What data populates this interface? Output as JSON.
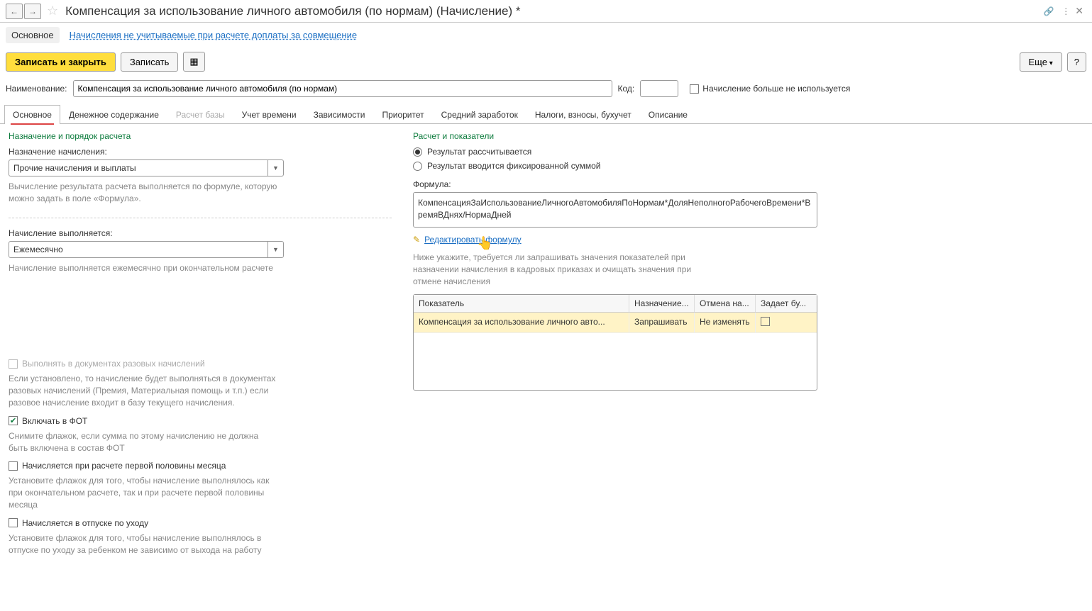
{
  "title": "Компенсация за использование личного автомобиля (по нормам) (Начисление) *",
  "subnav": {
    "main": "Основное",
    "link": "Начисления не учитываемые при расчете доплаты за совмещение"
  },
  "toolbar": {
    "save_close": "Записать и закрыть",
    "save": "Записать",
    "more": "Еще",
    "help": "?"
  },
  "fields": {
    "name_label": "Наименование:",
    "name_value": "Компенсация за использование личного автомобиля (по нормам)",
    "code_label": "Код:",
    "code_value": "",
    "not_used_label": "Начисление больше не используется"
  },
  "tabs": [
    "Основное",
    "Денежное содержание",
    "Расчет базы",
    "Учет времени",
    "Зависимости",
    "Приоритет",
    "Средний заработок",
    "Налоги, взносы, бухучет",
    "Описание"
  ],
  "left": {
    "section": "Назначение и порядок расчета",
    "nazn_label": "Назначение начисления:",
    "nazn_value": "Прочие начисления и выплаты",
    "nazn_hint": "Вычисление результата расчета выполняется по формуле, которую можно задать в поле «Формула».",
    "vyp_label": "Начисление выполняется:",
    "vyp_value": "Ежемесячно",
    "vyp_hint": "Начисление выполняется ежемесячно при окончательном расчете",
    "cb1_label": "Выполнять в документах разовых начислений",
    "cb1_hint": "Если установлено, то начисление будет выполняться в документах разовых начислений (Премия, Материальная помощь и т.п.) если разовое начисление входит в базу текущего начисления.",
    "cb2_label": "Включать в ФОТ",
    "cb2_hint": "Снимите флажок, если сумма по этому начислению не должна быть включена в состав ФОТ",
    "cb3_label": "Начисляется при расчете первой половины месяца",
    "cb3_hint": "Установите флажок для того, чтобы начисление выполнялось как при окончательном расчете, так и при расчете первой половины месяца",
    "cb4_label": "Начисляется в отпуске по уходу",
    "cb4_hint": "Установите флажок для того, чтобы начисление выполнялось в отпуске по уходу за ребенком не зависимо от выхода на работу"
  },
  "right": {
    "section": "Расчет и показатели",
    "r1": "Результат рассчитывается",
    "r2": "Результат вводится фиксированной суммой",
    "formula_label": "Формула:",
    "formula_text": "КомпенсацияЗаИспользованиеЛичногоАвтомобиляПоНормам*ДоляНеполногоРабочегоВремени*ВремяВДнях/НормаДней",
    "edit_link": "Редактировать формулу",
    "hint": "Ниже укажите, требуется ли запрашивать значения показателей при назначении начисления в кадровых приказах и очищать значения при отмене начисления",
    "th1": "Показатель",
    "th2": "Назначение...",
    "th3": "Отмена на...",
    "th4": "Задает бу...",
    "td1": "Компенсация за использование личного авто...",
    "td2": "Запрашивать",
    "td3": "Не изменять"
  }
}
